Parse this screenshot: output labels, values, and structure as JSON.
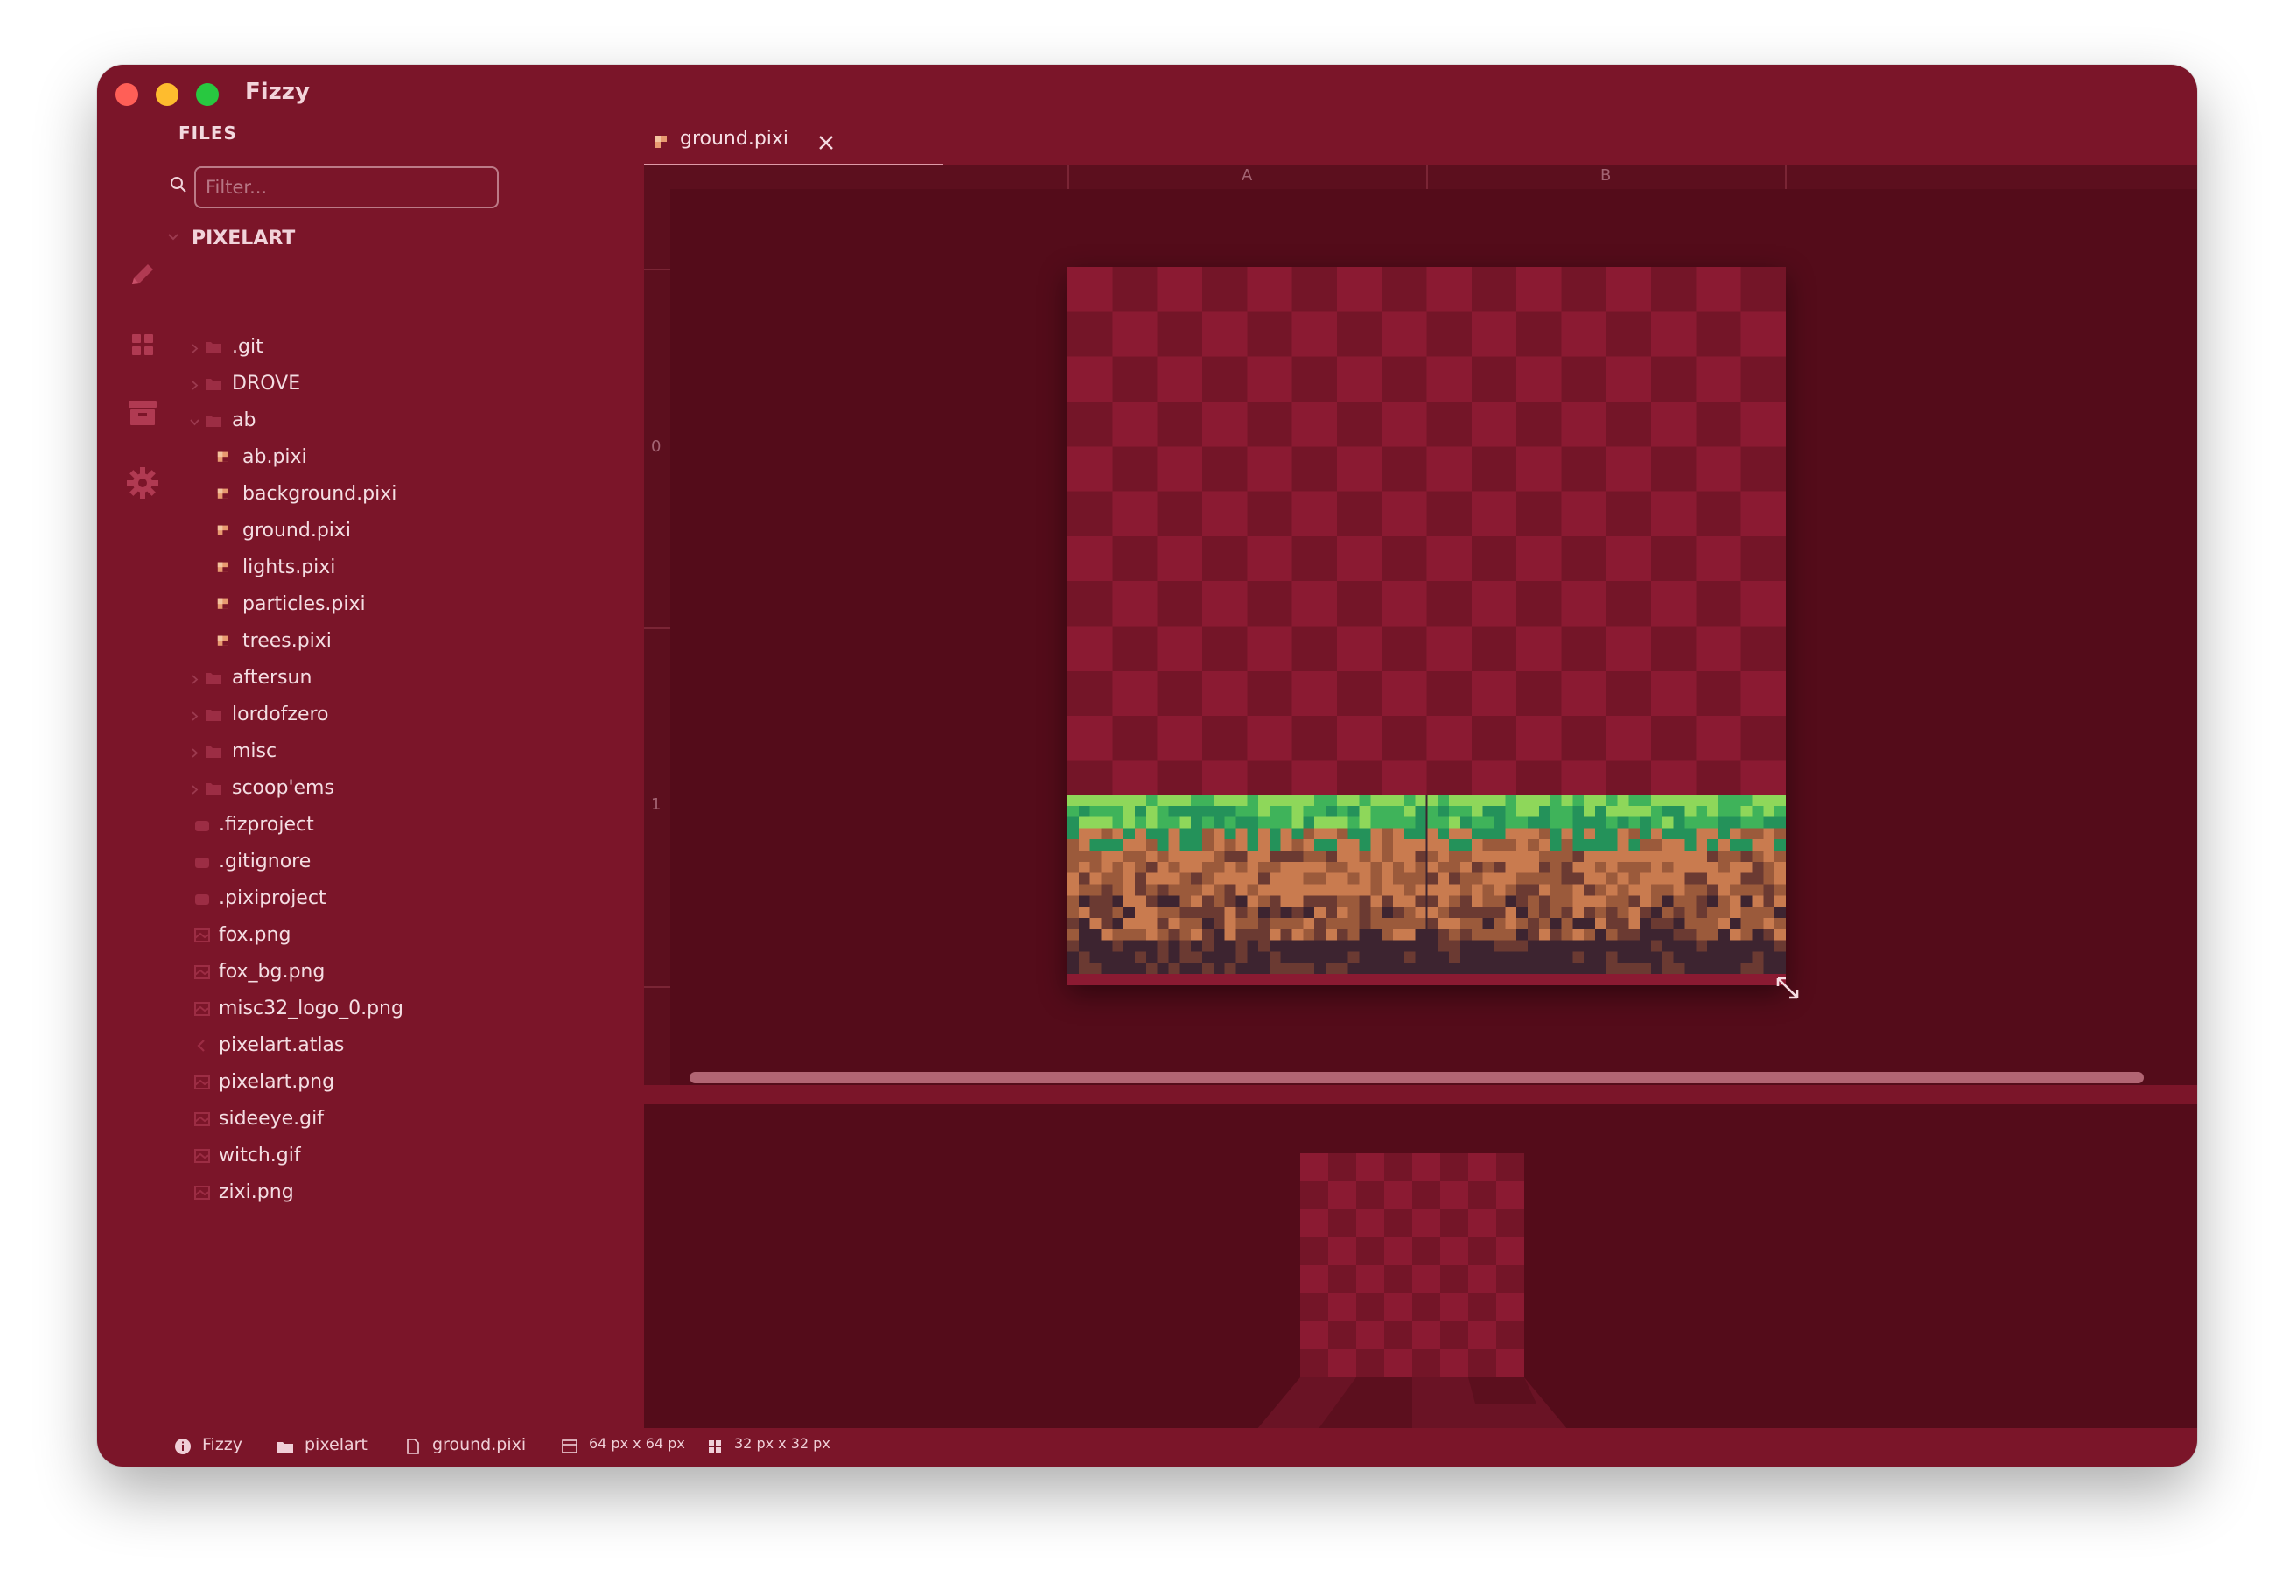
{
  "window": {
    "title": "Fizzy",
    "controls": {
      "close_color": "#ff5f57",
      "minimize_color": "#febc2e",
      "zoom_color": "#28c840"
    }
  },
  "theme": {
    "background": "#7b1529",
    "editor_background": "#540c1a",
    "text": "#f4dde2"
  },
  "activity_bar": [
    {
      "name": "pencil-icon"
    },
    {
      "name": "grid-icon"
    },
    {
      "name": "archive-icon"
    },
    {
      "name": "gear-icon"
    }
  ],
  "sidebar": {
    "heading": "FILES",
    "filter_placeholder": "Filter...",
    "root": "PIXELART",
    "tree": [
      {
        "label": ".git",
        "type": "folder",
        "depth": 0,
        "expanded": false
      },
      {
        "label": "DROVE",
        "type": "folder",
        "depth": 0,
        "expanded": false
      },
      {
        "label": "ab",
        "type": "folder",
        "depth": 0,
        "expanded": true
      },
      {
        "label": "ab.pixi",
        "type": "pixi",
        "depth": 1
      },
      {
        "label": "background.pixi",
        "type": "pixi",
        "depth": 1
      },
      {
        "label": "ground.pixi",
        "type": "pixi",
        "depth": 1
      },
      {
        "label": "lights.pixi",
        "type": "pixi",
        "depth": 1
      },
      {
        "label": "particles.pixi",
        "type": "pixi",
        "depth": 1
      },
      {
        "label": "trees.pixi",
        "type": "pixi",
        "depth": 1
      },
      {
        "label": "aftersun",
        "type": "folder",
        "depth": 0,
        "expanded": false
      },
      {
        "label": "lordofzero",
        "type": "folder",
        "depth": 0,
        "expanded": false
      },
      {
        "label": "misc",
        "type": "folder",
        "depth": 0,
        "expanded": false
      },
      {
        "label": "scoop'ems",
        "type": "folder",
        "depth": 0,
        "expanded": false
      },
      {
        "label": ".fizproject",
        "type": "project",
        "depth": 0
      },
      {
        "label": ".gitignore",
        "type": "project",
        "depth": 0
      },
      {
        "label": ".pixiproject",
        "type": "project",
        "depth": 0
      },
      {
        "label": "fox.png",
        "type": "image",
        "depth": 0
      },
      {
        "label": "fox_bg.png",
        "type": "image",
        "depth": 0
      },
      {
        "label": "misc32_logo_0.png",
        "type": "image",
        "depth": 0
      },
      {
        "label": "pixelart.atlas",
        "type": "code",
        "depth": 0
      },
      {
        "label": "pixelart.png",
        "type": "image",
        "depth": 0
      },
      {
        "label": "sideeye.gif",
        "type": "image",
        "depth": 0
      },
      {
        "label": "witch.gif",
        "type": "image",
        "depth": 0
      },
      {
        "label": "zixi.png",
        "type": "image",
        "depth": 0
      }
    ]
  },
  "tabs": [
    {
      "label": "ground.pixi",
      "active": true
    }
  ],
  "editor": {
    "ruler_columns": [
      "A",
      "B"
    ],
    "ruler_rows": [
      "0",
      "1"
    ]
  },
  "status_bar": {
    "app": "Fizzy",
    "project": "pixelart",
    "file": "ground.pixi",
    "canvas_size": "64 px x 64 px",
    "grid_size": "32 px x 32 px"
  }
}
